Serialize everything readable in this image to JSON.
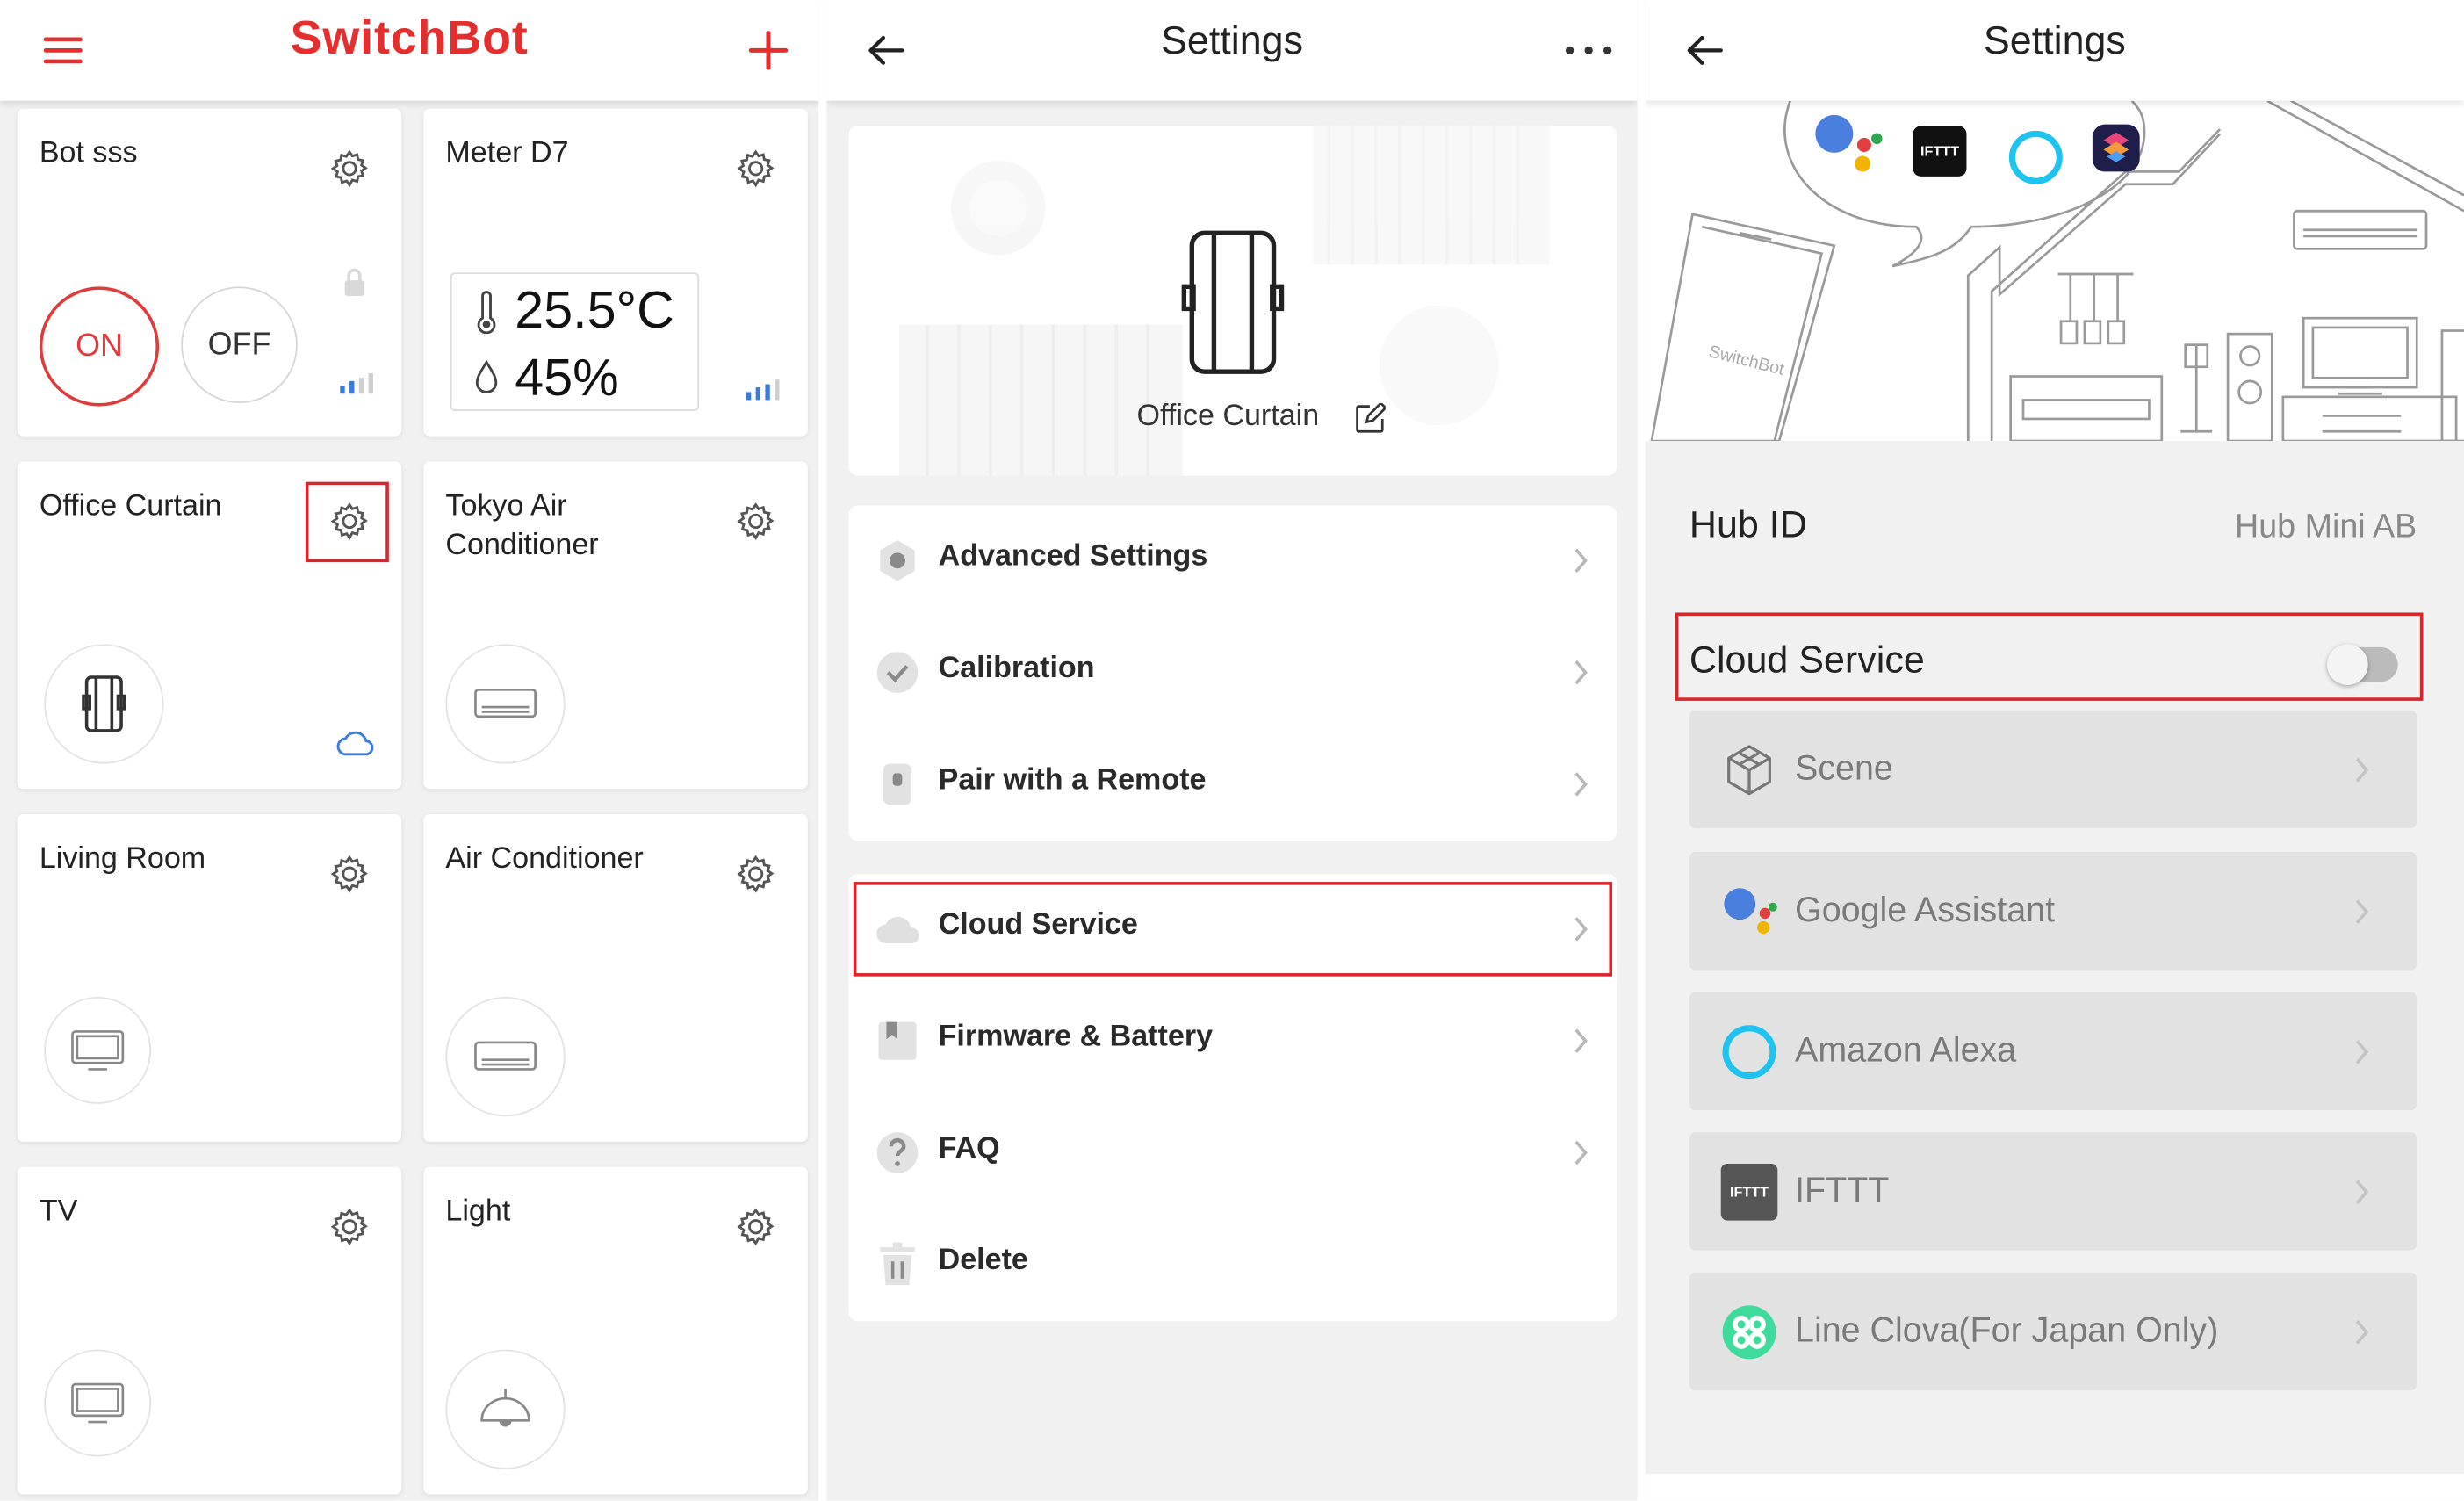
{
  "panel1": {
    "brand": "SwitchBot",
    "cards": [
      {
        "name": "Bot sss",
        "type": "bot",
        "on_label": "ON",
        "off_label": "OFF"
      },
      {
        "name": "Meter D7",
        "type": "meter",
        "temperature": "25.5°C",
        "humidity": "45%"
      },
      {
        "name": "Office Curtain",
        "type": "curtain",
        "highlighted_gear": true
      },
      {
        "name": "Tokyo Air Conditioner",
        "type": "ac"
      },
      {
        "name": "Living Room",
        "type": "tv"
      },
      {
        "name": "Air Conditioner",
        "type": "ac"
      },
      {
        "name": "TV",
        "type": "tv"
      },
      {
        "name": "Light",
        "type": "light"
      }
    ]
  },
  "panel2": {
    "title": "Settings",
    "device_name": "Office Curtain",
    "rows_group1": [
      {
        "label": "Advanced Settings",
        "icon": "gear-dot-icon"
      },
      {
        "label": "Calibration",
        "icon": "check-icon"
      },
      {
        "label": "Pair with a Remote",
        "icon": "remote-icon"
      }
    ],
    "rows_group2": [
      {
        "label": "Cloud Service",
        "icon": "cloud-icon",
        "highlighted": true
      },
      {
        "label": "Firmware & Battery",
        "icon": "bookmark-icon"
      },
      {
        "label": "FAQ",
        "icon": "question-icon"
      },
      {
        "label": "Delete",
        "icon": "trash-icon"
      }
    ]
  },
  "panel3": {
    "title": "Settings",
    "hub_id_label": "Hub ID",
    "hub_id_value": "Hub Mini AB",
    "cloud_service_label": "Cloud Service",
    "cloud_service_enabled": false,
    "services": [
      {
        "label": "Scene",
        "icon": "cube-icon"
      },
      {
        "label": "Google Assistant",
        "icon": "google-assistant-icon"
      },
      {
        "label": "Amazon Alexa",
        "icon": "alexa-icon"
      },
      {
        "label": "IFTTT",
        "icon": "ifttt-icon"
      },
      {
        "label": "Line Clova(For Japan Only)",
        "icon": "clova-icon"
      }
    ],
    "illustration_phone_text": "SwitchBot",
    "illustration_ifttt_text": "IFTTT"
  },
  "colors": {
    "brand_red": "#e52f2f",
    "highlight": "#d9252b",
    "blue_signal": "#3b7be0"
  }
}
